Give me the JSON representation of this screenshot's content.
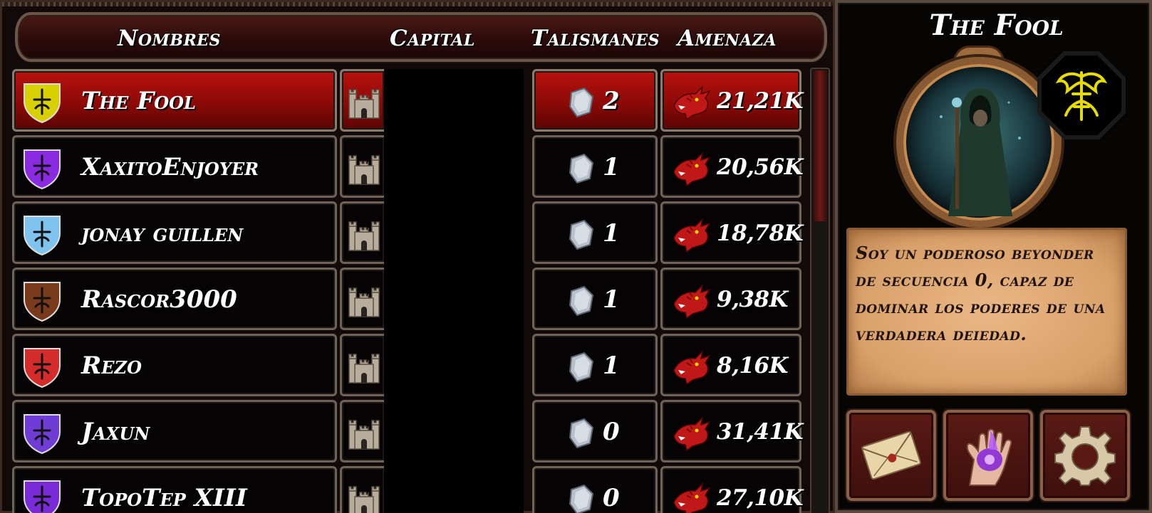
{
  "headers": {
    "names": "Nombres",
    "capital": "Capital",
    "talismans": "Talismanes",
    "threat": "Amenaza"
  },
  "players": [
    {
      "name": "The Fool",
      "talismans": "2",
      "threat": "21,21K",
      "crest_icon": "fool-crest-icon",
      "crest_color": "#d8d000",
      "selected": true
    },
    {
      "name": "XaxitoEnjoyer",
      "talismans": "1",
      "threat": "20,56K",
      "crest_icon": "purple-shield-crest-icon",
      "crest_color": "#8a2be2",
      "selected": false
    },
    {
      "name": "jonay guillen",
      "talismans": "1",
      "threat": "18,78K",
      "crest_icon": "longship-shield-crest-icon",
      "crest_color": "#7fc4ee",
      "selected": false
    },
    {
      "name": "Rascor3000",
      "talismans": "1",
      "threat": "9,38K",
      "crest_icon": "brown-bat-crest-icon",
      "crest_color": "#7a3a1c",
      "selected": false
    },
    {
      "name": "Rezo",
      "talismans": "1",
      "threat": "8,16K",
      "crest_icon": "red-knot-shield-crest-icon",
      "crest_color": "#d42b2b",
      "selected": false
    },
    {
      "name": "Jaxun",
      "talismans": "0",
      "threat": "31,41K",
      "crest_icon": "horse-shield-crest-icon",
      "crest_color": "#6f3dd6",
      "selected": false
    },
    {
      "name": "TopoTep XIII",
      "talismans": "0",
      "threat": "27,10K",
      "crest_icon": "purple-crest-icon",
      "crest_color": "#7a2bd8",
      "selected": false
    }
  ],
  "profile": {
    "title": "The Fool",
    "bio": "Soy un poderoso beyonder de secuencia 0, capaz de dominar los poderes de una verdadera deiedad.",
    "emblem_color": "#e6dc00",
    "accent_color": "#a80c08"
  },
  "buttons": {
    "mail_icon": "sealed-letter-icon",
    "hand_icon": "magic-hand-icon",
    "settings_icon": "gear-icon"
  }
}
